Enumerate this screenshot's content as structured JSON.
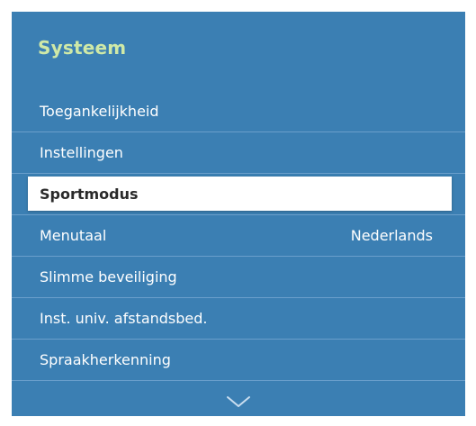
{
  "panel": {
    "title": "Systeem"
  },
  "menu": {
    "items": [
      {
        "label": "Toegankelijkheid",
        "value": ""
      },
      {
        "label": "Instellingen",
        "value": ""
      },
      {
        "label": "Sportmodus",
        "value": ""
      },
      {
        "label": "Menutaal",
        "value": "Nederlands"
      },
      {
        "label": "Slimme beveiliging",
        "value": ""
      },
      {
        "label": "Inst. univ. afstandsbed.",
        "value": ""
      },
      {
        "label": "Spraakherkenning",
        "value": ""
      }
    ],
    "selected_index": 2
  },
  "icons": {
    "scroll_down": "chevron-down-icon"
  },
  "colors": {
    "panel_bg": "#3b7fb3",
    "title": "#cfe9a7",
    "highlight": "#ffffff",
    "text": "#ffffff",
    "selected_text": "#2a2a2a"
  }
}
